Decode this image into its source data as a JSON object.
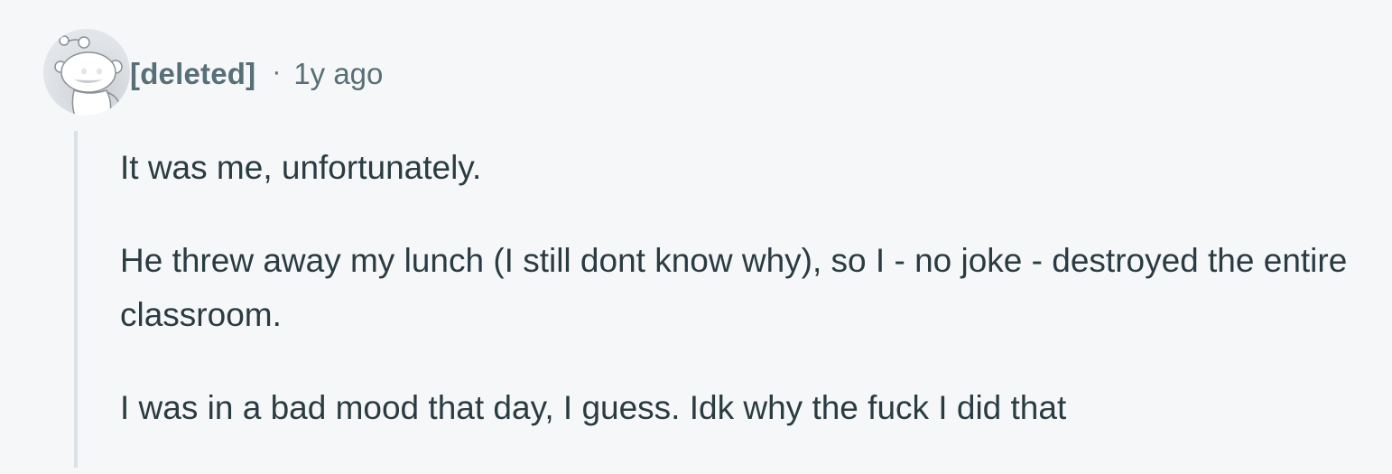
{
  "comment": {
    "author": "[deleted]",
    "separator": "·",
    "timestamp": "1y ago",
    "avatar_icon": "snoo-avatar-icon",
    "paragraphs": [
      "It was me, unfortunately.",
      "He threw away my lunch (I still dont know why), so I - no joke - destroyed the entire classroom.",
      "I was in a bad mood that day, I guess. Idk why the fuck I did that"
    ]
  },
  "colors": {
    "background": "#f6f7f8",
    "meta_text": "#576f76",
    "body_text": "#2a3c42",
    "thread_line": "#dbe1e4"
  }
}
